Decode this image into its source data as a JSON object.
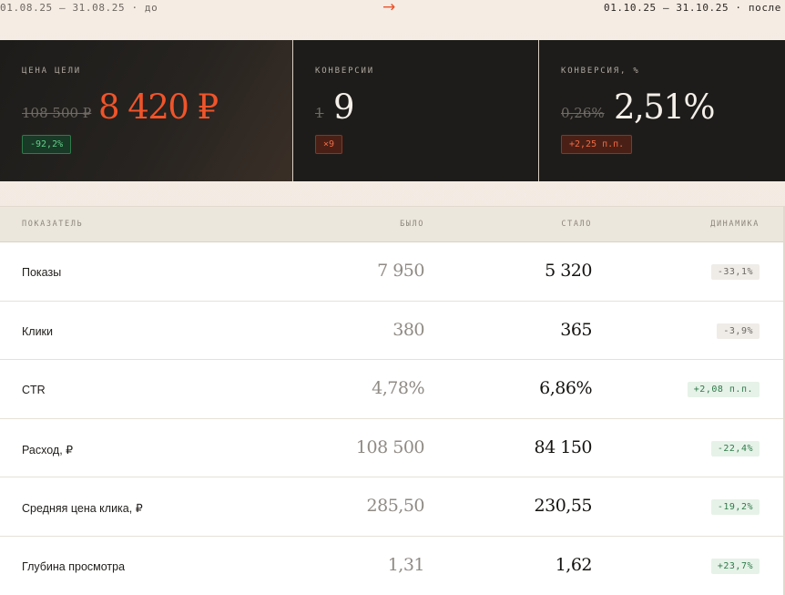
{
  "period": {
    "before": "01.08.25 — 31.08.25 · до",
    "arrow": "→",
    "after": "01.10.25 — 31.10.25 · после"
  },
  "cards": [
    {
      "label": "ЦЕНА ЦЕЛИ",
      "old": "108 500 ₽",
      "new": "8 420 ₽",
      "badge": "-92,2%"
    },
    {
      "label": "КОНВЕРСИИ",
      "old": "1",
      "new": "9",
      "badge": "×9"
    },
    {
      "label": "КОНВЕРСИЯ, %",
      "old": "0,26%",
      "new": "2,51%",
      "badge": "+2,25 п.п."
    }
  ],
  "table": {
    "headers": [
      "ПОКАЗАТЕЛЬ",
      "БЫЛО",
      "СТАЛО",
      "ДИНАМИКА"
    ],
    "rows": [
      {
        "name": "Показы",
        "was": "7 950",
        "now": "5 320",
        "change": "-33,1%"
      },
      {
        "name": "Клики",
        "was": "380",
        "now": "365",
        "change": "-3,9%"
      },
      {
        "name": "CTR",
        "was": "4,78%",
        "now": "6,86%",
        "change": "+2,08 п.п."
      },
      {
        "name": "Расход, ₽",
        "was": "108 500",
        "now": "84 150",
        "change": "-22,4%"
      },
      {
        "name": "Средняя цена клика, ₽",
        "was": "285,50",
        "now": "230,55",
        "change": "-19,2%"
      },
      {
        "name": "Глубина просмотра",
        "was": "1,31",
        "now": "1,62",
        "change": "+23,7%"
      }
    ]
  },
  "colors": {
    "accent": "#f0542a",
    "positive": "#2f7a4a",
    "card_bg": "#1d1c1a"
  }
}
